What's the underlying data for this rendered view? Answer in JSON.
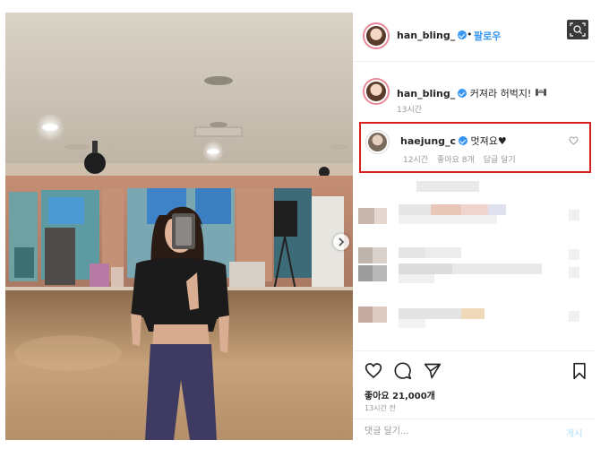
{
  "post": {
    "author": {
      "username": "han_bling_",
      "verified": true
    },
    "follow_separator": "•",
    "follow_label": "팔로우",
    "caption": {
      "username": "han_bling_",
      "text": "커져라 허벅지! ",
      "emoji": "dumbbell"
    },
    "caption_time": "13시간",
    "highlighted_comment": {
      "username": "haejung_c",
      "verified": true,
      "text": "멋져요♥",
      "time": "12시간",
      "likes": "좋아요 8개",
      "reply_label": "답글 달기"
    },
    "likes_text": "좋아요 21,000개",
    "posted_time": "13시간 전",
    "comment_placeholder": "댓글 달기...",
    "post_label": "게시"
  },
  "icons": [
    "scan-icon",
    "heart-icon",
    "comment-icon",
    "share-icon",
    "bookmark-icon",
    "chevron-right-icon"
  ],
  "colors": {
    "accent": "#3897f0",
    "highlight": "#d82222",
    "muted": "#999999"
  }
}
